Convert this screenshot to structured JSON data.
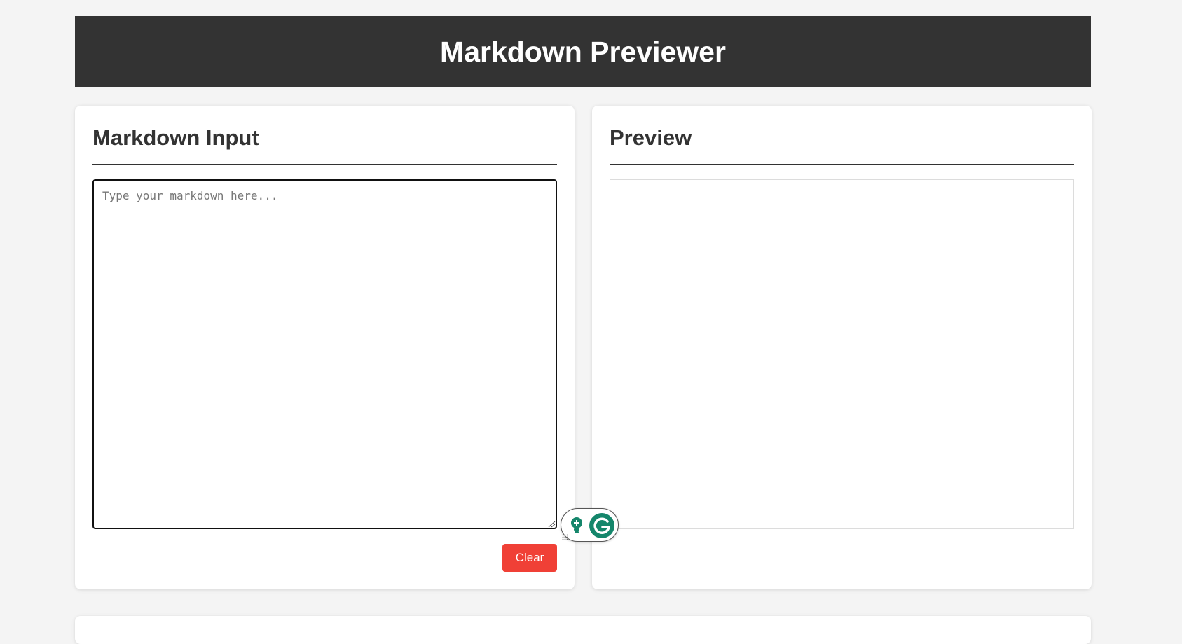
{
  "header": {
    "title": "Markdown Previewer"
  },
  "editor": {
    "title": "Markdown Input",
    "value": "",
    "placeholder": "Type your markdown here...",
    "clear_label": "Clear"
  },
  "preview": {
    "title": "Preview"
  },
  "colors": {
    "header_bg": "#333333",
    "clear_button": "#f04036",
    "grammarly_green": "#15866b"
  },
  "icons": {
    "grammarly_bulb": "lightbulb-icon",
    "grammarly_logo": "grammarly-g-icon",
    "resize": "resize-grip-icon"
  }
}
